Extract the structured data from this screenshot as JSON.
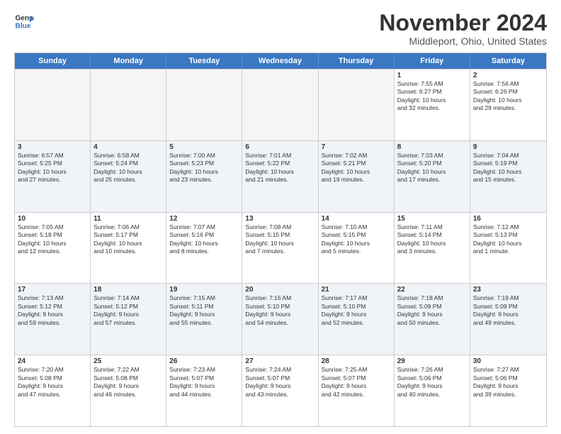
{
  "logo": {
    "line1": "General",
    "line2": "Blue"
  },
  "title": "November 2024",
  "location": "Middleport, Ohio, United States",
  "weekdays": [
    "Sunday",
    "Monday",
    "Tuesday",
    "Wednesday",
    "Thursday",
    "Friday",
    "Saturday"
  ],
  "rows": [
    [
      {
        "day": "",
        "info": ""
      },
      {
        "day": "",
        "info": ""
      },
      {
        "day": "",
        "info": ""
      },
      {
        "day": "",
        "info": ""
      },
      {
        "day": "",
        "info": ""
      },
      {
        "day": "1",
        "info": "Sunrise: 7:55 AM\nSunset: 6:27 PM\nDaylight: 10 hours\nand 32 minutes."
      },
      {
        "day": "2",
        "info": "Sunrise: 7:56 AM\nSunset: 6:26 PM\nDaylight: 10 hours\nand 29 minutes."
      }
    ],
    [
      {
        "day": "3",
        "info": "Sunrise: 6:57 AM\nSunset: 5:25 PM\nDaylight: 10 hours\nand 27 minutes."
      },
      {
        "day": "4",
        "info": "Sunrise: 6:58 AM\nSunset: 5:24 PM\nDaylight: 10 hours\nand 25 minutes."
      },
      {
        "day": "5",
        "info": "Sunrise: 7:00 AM\nSunset: 5:23 PM\nDaylight: 10 hours\nand 23 minutes."
      },
      {
        "day": "6",
        "info": "Sunrise: 7:01 AM\nSunset: 5:22 PM\nDaylight: 10 hours\nand 21 minutes."
      },
      {
        "day": "7",
        "info": "Sunrise: 7:02 AM\nSunset: 5:21 PM\nDaylight: 10 hours\nand 19 minutes."
      },
      {
        "day": "8",
        "info": "Sunrise: 7:03 AM\nSunset: 5:20 PM\nDaylight: 10 hours\nand 17 minutes."
      },
      {
        "day": "9",
        "info": "Sunrise: 7:04 AM\nSunset: 5:19 PM\nDaylight: 10 hours\nand 15 minutes."
      }
    ],
    [
      {
        "day": "10",
        "info": "Sunrise: 7:05 AM\nSunset: 5:18 PM\nDaylight: 10 hours\nand 12 minutes."
      },
      {
        "day": "11",
        "info": "Sunrise: 7:06 AM\nSunset: 5:17 PM\nDaylight: 10 hours\nand 10 minutes."
      },
      {
        "day": "12",
        "info": "Sunrise: 7:07 AM\nSunset: 5:16 PM\nDaylight: 10 hours\nand 8 minutes."
      },
      {
        "day": "13",
        "info": "Sunrise: 7:08 AM\nSunset: 5:15 PM\nDaylight: 10 hours\nand 7 minutes."
      },
      {
        "day": "14",
        "info": "Sunrise: 7:10 AM\nSunset: 5:15 PM\nDaylight: 10 hours\nand 5 minutes."
      },
      {
        "day": "15",
        "info": "Sunrise: 7:11 AM\nSunset: 5:14 PM\nDaylight: 10 hours\nand 3 minutes."
      },
      {
        "day": "16",
        "info": "Sunrise: 7:12 AM\nSunset: 5:13 PM\nDaylight: 10 hours\nand 1 minute."
      }
    ],
    [
      {
        "day": "17",
        "info": "Sunrise: 7:13 AM\nSunset: 5:12 PM\nDaylight: 9 hours\nand 59 minutes."
      },
      {
        "day": "18",
        "info": "Sunrise: 7:14 AM\nSunset: 5:12 PM\nDaylight: 9 hours\nand 57 minutes."
      },
      {
        "day": "19",
        "info": "Sunrise: 7:15 AM\nSunset: 5:11 PM\nDaylight: 9 hours\nand 55 minutes."
      },
      {
        "day": "20",
        "info": "Sunrise: 7:16 AM\nSunset: 5:10 PM\nDaylight: 9 hours\nand 54 minutes."
      },
      {
        "day": "21",
        "info": "Sunrise: 7:17 AM\nSunset: 5:10 PM\nDaylight: 9 hours\nand 52 minutes."
      },
      {
        "day": "22",
        "info": "Sunrise: 7:18 AM\nSunset: 5:09 PM\nDaylight: 9 hours\nand 50 minutes."
      },
      {
        "day": "23",
        "info": "Sunrise: 7:19 AM\nSunset: 5:09 PM\nDaylight: 9 hours\nand 49 minutes."
      }
    ],
    [
      {
        "day": "24",
        "info": "Sunrise: 7:20 AM\nSunset: 5:08 PM\nDaylight: 9 hours\nand 47 minutes."
      },
      {
        "day": "25",
        "info": "Sunrise: 7:22 AM\nSunset: 5:08 PM\nDaylight: 9 hours\nand 46 minutes."
      },
      {
        "day": "26",
        "info": "Sunrise: 7:23 AM\nSunset: 5:07 PM\nDaylight: 9 hours\nand 44 minutes."
      },
      {
        "day": "27",
        "info": "Sunrise: 7:24 AM\nSunset: 5:07 PM\nDaylight: 9 hours\nand 43 minutes."
      },
      {
        "day": "28",
        "info": "Sunrise: 7:25 AM\nSunset: 5:07 PM\nDaylight: 9 hours\nand 42 minutes."
      },
      {
        "day": "29",
        "info": "Sunrise: 7:26 AM\nSunset: 5:06 PM\nDaylight: 9 hours\nand 40 minutes."
      },
      {
        "day": "30",
        "info": "Sunrise: 7:27 AM\nSunset: 5:06 PM\nDaylight: 9 hours\nand 39 minutes."
      }
    ]
  ]
}
